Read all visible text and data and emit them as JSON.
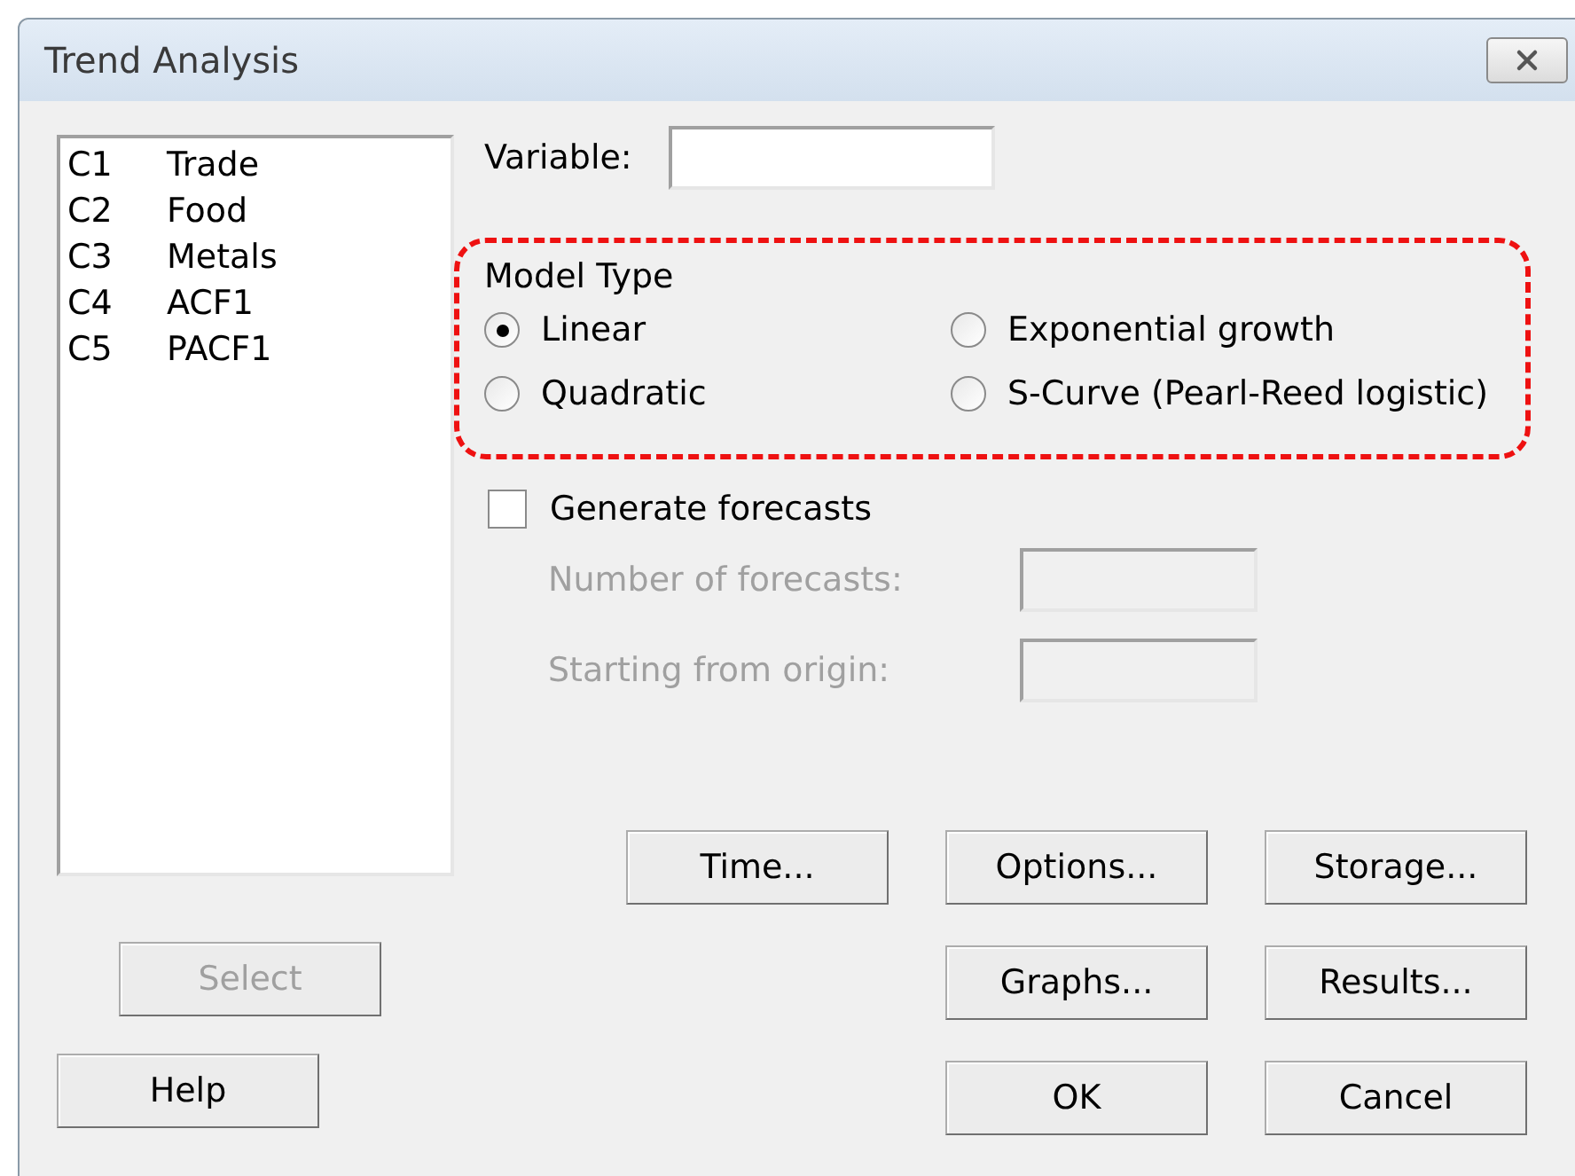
{
  "window": {
    "title": "Trend Analysis"
  },
  "columns": [
    {
      "id": "C1",
      "name": "Trade"
    },
    {
      "id": "C2",
      "name": "Food"
    },
    {
      "id": "C3",
      "name": "Metals"
    },
    {
      "id": "C4",
      "name": "ACF1"
    },
    {
      "id": "C5",
      "name": "PACF1"
    }
  ],
  "variable": {
    "label": "Variable:"
  },
  "model_type": {
    "title": "Model Type",
    "options": [
      {
        "label": "Linear",
        "selected": true
      },
      {
        "label": "Exponential growth",
        "selected": false
      },
      {
        "label": "Quadratic",
        "selected": false
      },
      {
        "label": "S-Curve (Pearl-Reed logistic)",
        "selected": false
      }
    ]
  },
  "forecasts": {
    "label": "Generate forecasts",
    "checked": false,
    "fields": [
      {
        "label": "Number of forecasts:",
        "disabled": true
      },
      {
        "label": "Starting from origin:",
        "disabled": true
      }
    ]
  },
  "left_buttons": [
    {
      "label": "Select",
      "disabled": true
    },
    {
      "label": "Help",
      "disabled": false
    }
  ],
  "right_buttons": [
    [
      {
        "label": "Time...",
        "disabled": false
      },
      {
        "label": "Options...",
        "disabled": false
      },
      {
        "label": "Storage...",
        "disabled": false
      }
    ],
    [
      {
        "label": "Graphs...",
        "disabled": false
      },
      {
        "label": "Results...",
        "disabled": false
      }
    ],
    [
      {
        "label": "OK",
        "disabled": false
      },
      {
        "label": "Cancel",
        "disabled": false
      }
    ]
  ]
}
